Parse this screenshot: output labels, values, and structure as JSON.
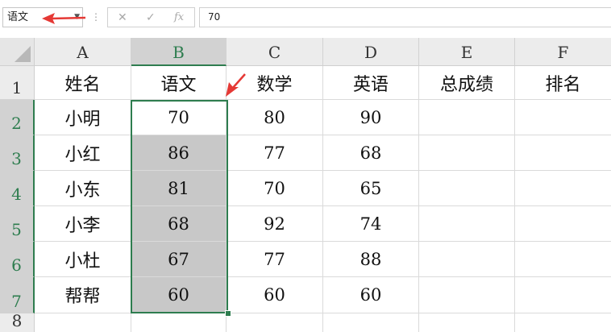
{
  "formula_bar": {
    "name_box": "语文",
    "menu_dots": "⋮",
    "cancel_glyph": "✕",
    "confirm_glyph": "✓",
    "fx_glyph": "fx",
    "formula_value": "70"
  },
  "columns": [
    "A",
    "B",
    "C",
    "D",
    "E",
    "F"
  ],
  "rows": [
    "1",
    "2",
    "3",
    "4",
    "5",
    "6",
    "7",
    "8"
  ],
  "table": {
    "headers": [
      "姓名",
      "语文",
      "数学",
      "英语",
      "总成绩",
      "排名"
    ],
    "data": [
      [
        "小明",
        "70",
        "80",
        "90",
        "",
        ""
      ],
      [
        "小红",
        "86",
        "77",
        "68",
        "",
        ""
      ],
      [
        "小东",
        "81",
        "70",
        "65",
        "",
        ""
      ],
      [
        "小李",
        "68",
        "92",
        "74",
        "",
        ""
      ],
      [
        "小杜",
        "67",
        "77",
        "88",
        "",
        ""
      ],
      [
        "帮帮",
        "60",
        "60",
        "60",
        "",
        ""
      ]
    ]
  },
  "selection": {
    "column": "B",
    "active_cell": "B2",
    "range": "B1:B7"
  },
  "colors": {
    "accent_green": "#2e7d4f",
    "annotation_red": "#e53935",
    "selection_fill": "#c8c8c8"
  }
}
